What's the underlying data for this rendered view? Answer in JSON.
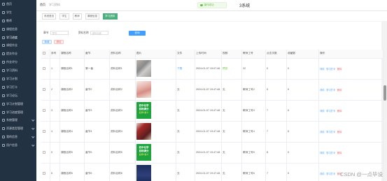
{
  "sidebar": {
    "items": [
      {
        "label": "首页",
        "icon": "home-icon",
        "expand": false
      },
      {
        "label": "学生",
        "icon": "user-icon",
        "expand": false
      },
      {
        "label": "教师",
        "icon": "user-icon",
        "expand": false
      },
      {
        "label": "课程信息",
        "icon": "book-icon",
        "expand": false
      },
      {
        "label": "学习进度",
        "icon": "progress-icon",
        "expand": false
      },
      {
        "label": "课程作业",
        "icon": "file-icon",
        "expand": false
      },
      {
        "label": "提交作业",
        "icon": "upload-icon",
        "expand": false
      },
      {
        "label": "作业评分",
        "icon": "star-icon",
        "expand": false
      },
      {
        "label": "学习资料",
        "icon": "folder-icon",
        "expand": false
      },
      {
        "label": "学习计划",
        "icon": "calendar-icon",
        "expand": false
      },
      {
        "label": "学习打卡",
        "icon": "check-icon",
        "expand": false
      },
      {
        "label": "学习论坛",
        "icon": "chat-icon",
        "expand": false
      },
      {
        "label": "学习计划管理",
        "icon": "list-icon",
        "expand": false
      },
      {
        "label": "学习进度管理",
        "icon": "chart-icon",
        "expand": false
      },
      {
        "label": "系统管理",
        "icon": "gear-icon",
        "expand": true
      },
      {
        "label": "资源类型管理",
        "icon": "tag-icon",
        "expand": true
      },
      {
        "label": "我的信息",
        "icon": "person-icon",
        "expand": true
      },
      {
        "label": "用户信息",
        "icon": "info-icon",
        "expand": true
      }
    ]
  },
  "topbar": {
    "tab_home": "首页",
    "tab_current": "学习资料"
  },
  "toast": {
    "text": "操作成功"
  },
  "system_title": "3系统",
  "breadcrumb": {
    "items": [
      "系统首页",
      "学生",
      "教师",
      "课程信息"
    ],
    "active": "学习资料"
  },
  "search": {
    "label1": "章节",
    "placeholder1": "章节",
    "label2": "资料名称",
    "placeholder2": "资料名称",
    "button": "查询"
  },
  "actions": {
    "add": "新增",
    "delete": "删除"
  },
  "table": {
    "headers": [
      "",
      "序号",
      "课程名称",
      "章节",
      "资料名称",
      "图片",
      "文件",
      "上传时间",
      "视频",
      "教师工号",
      "点击次数",
      "收藏数",
      "操作"
    ],
    "rows": [
      {
        "index": "1",
        "course": "课程名称1",
        "chapter": "第一章",
        "name": "资料名称1",
        "img": "book1",
        "file": "下载",
        "time": "2024-01-07 19:07:46",
        "video": "预览",
        "teacher": "22",
        "clicks": "0",
        "fav": "0"
      },
      {
        "index": "2",
        "course": "课程名称2",
        "chapter": "章节2",
        "name": "资料名称2",
        "img": "book2",
        "file": "无",
        "time": "2024-01-07 19:47:48",
        "video": "无",
        "teacher": "教师工号2",
        "clicks": "5",
        "fav": "5"
      },
      {
        "index": "3",
        "course": "课程名称3",
        "chapter": "章节3",
        "name": "资料名称3",
        "img": "green",
        "file": "无",
        "time": "2024-01-07 19:47:48",
        "video": "无",
        "teacher": "教师工号3",
        "clicks": "7",
        "fav": "6"
      },
      {
        "index": "4",
        "course": "课程名称4",
        "chapter": "章节4",
        "name": "资料名称4",
        "img": "red",
        "file": "无",
        "time": "2024-01-07 19:47:48",
        "video": "无",
        "teacher": "教师工号4",
        "clicks": "7",
        "fav": "6"
      },
      {
        "index": "5",
        "course": "课程名称5",
        "chapter": "章节5",
        "name": "资料名称5",
        "img": "green",
        "file": "无",
        "time": "2024-01-07 19:47:48",
        "video": "无",
        "teacher": "教师工号5",
        "clicks": "8",
        "fav": "5"
      },
      {
        "index": "6",
        "course": "课程名称6",
        "chapter": "章节6",
        "name": "资料名称6",
        "img": "navy",
        "file": "无",
        "time": "2024-01-07 19:47:48",
        "video": "无",
        "teacher": "教师工号6",
        "clicks": "7",
        "fav": "5"
      }
    ],
    "op_edit": "详情",
    "op_study": "学习打卡",
    "op_del": "删除",
    "book_cover": {
      "line1": "初中化学",
      "line2": "目标满分",
      "line3": "名师×讲义"
    }
  },
  "watermark": "CSDN @一点毕设"
}
